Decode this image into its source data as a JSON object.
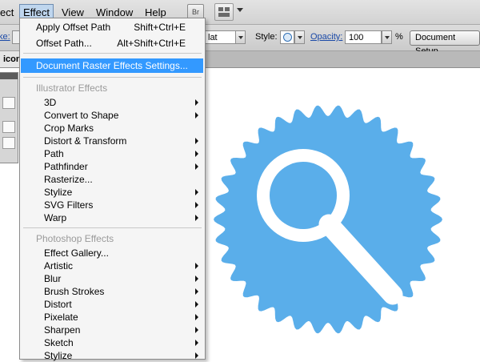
{
  "menubar": {
    "items": [
      "ect",
      "Effect",
      "View",
      "Window",
      "Help"
    ],
    "bridge_label": "Br"
  },
  "controlbar": {
    "left_label": "ke:",
    "brush_value": "lat",
    "style_label": "Style:",
    "opacity_label": "Opacity:",
    "opacity_value": "100",
    "percent": "%",
    "document_setup": "Document Setup"
  },
  "document": {
    "tab_label": "icon"
  },
  "effect_menu": {
    "top_items": [
      {
        "label": "Apply Offset Path",
        "shortcut": "Shift+Ctrl+E"
      },
      {
        "label": "Offset Path...",
        "shortcut": "Alt+Shift+Ctrl+E"
      }
    ],
    "highlighted": "Document Raster Effects Settings...",
    "illustrator_header": "Illustrator Effects",
    "illustrator_items": [
      "3D",
      "Convert to Shape",
      "Crop Marks",
      "Distort & Transform",
      "Path",
      "Pathfinder",
      "Rasterize...",
      "Stylize",
      "SVG Filters",
      "Warp"
    ],
    "photoshop_header": "Photoshop Effects",
    "photoshop_items": [
      "Effect Gallery...",
      "Artistic",
      "Blur",
      "Brush Strokes",
      "Distort",
      "Pixelate",
      "Sharpen",
      "Sketch",
      "Stylize"
    ]
  },
  "colors": {
    "badge_fill": "#5aaeea",
    "menu_highlight": "#3399ff",
    "menu_bg": "#f5f5f5"
  },
  "icons": {
    "artwork": "magnifier-badge-icon"
  }
}
